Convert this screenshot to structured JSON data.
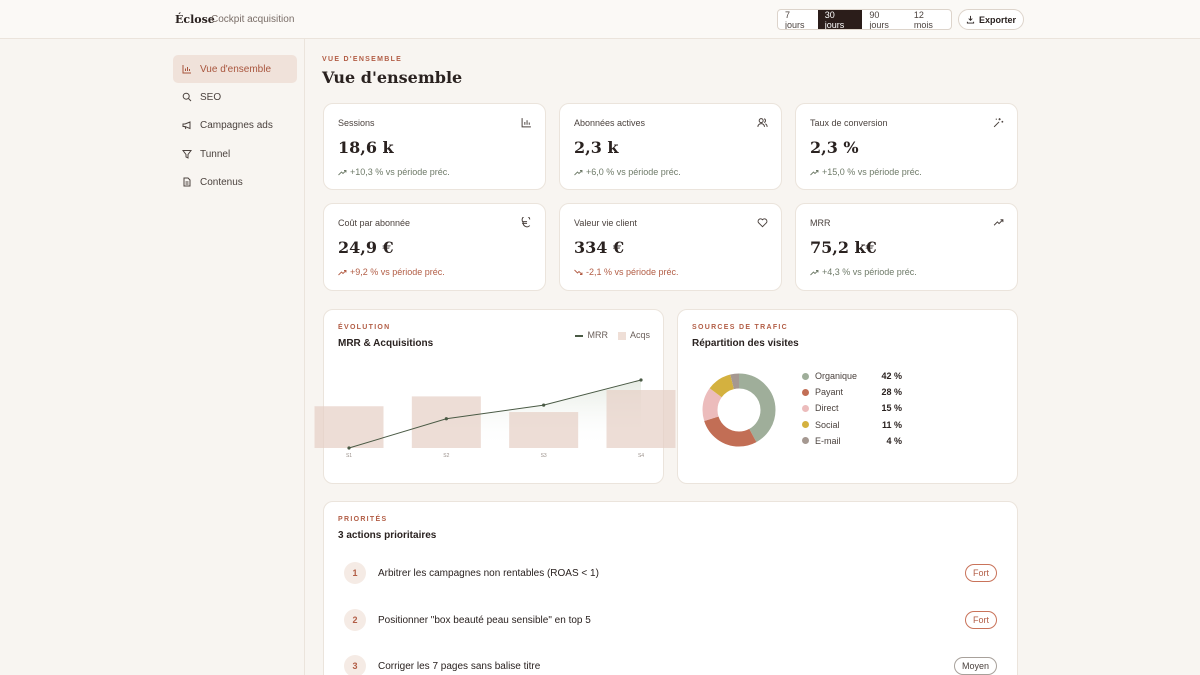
{
  "header": {
    "brand": "Éclose",
    "subtitle": "Cockpit acquisition",
    "periods": [
      "7 jours",
      "30 jours",
      "90 jours",
      "12 mois"
    ],
    "active_period": "30 jours",
    "export_label": "Exporter"
  },
  "sidebar": {
    "items": [
      {
        "label": "Vue d'ensemble",
        "icon": "bar-chart-icon",
        "active": true
      },
      {
        "label": "SEO",
        "icon": "search-icon",
        "active": false
      },
      {
        "label": "Campagnes ads",
        "icon": "megaphone-icon",
        "active": false
      },
      {
        "label": "Tunnel",
        "icon": "funnel-icon",
        "active": false
      },
      {
        "label": "Contenus",
        "icon": "document-icon",
        "active": false
      }
    ]
  },
  "page": {
    "eyebrow": "VUE D'ENSEMBLE",
    "title": "Vue d'ensemble"
  },
  "kpis": [
    {
      "label": "Sessions",
      "value": "18,6 k",
      "delta": "+10,3 % vs période préc.",
      "trend": "up",
      "icon": "bar-chart-icon"
    },
    {
      "label": "Abonnées actives",
      "value": "2,3 k",
      "delta": "+6,0 % vs période préc.",
      "trend": "up",
      "icon": "users-icon"
    },
    {
      "label": "Taux de conversion",
      "value": "2,3 %",
      "delta": "+15,0 % vs période préc.",
      "trend": "up",
      "icon": "sparkle-icon"
    },
    {
      "label": "Coût par abonnée",
      "value": "24,9 €",
      "delta": "+9,2 % vs période préc.",
      "trend": "up-bad",
      "icon": "euro-icon"
    },
    {
      "label": "Valeur vie client",
      "value": "334 €",
      "delta": "-2,1 % vs période préc.",
      "trend": "down",
      "icon": "heart-icon"
    },
    {
      "label": "MRR",
      "value": "75,2 k€",
      "delta": "+4,3 % vs période préc.",
      "trend": "up",
      "icon": "trend-up-icon"
    }
  ],
  "evolution": {
    "eyebrow": "ÉVOLUTION",
    "title": "MRR & Acquisitions",
    "legend_line": "MRR",
    "legend_bar": "Acqs"
  },
  "chart_data": {
    "type": "bar",
    "categories": [
      "S1",
      "S2",
      "S3",
      "S4"
    ],
    "series": [
      {
        "name": "MRR",
        "values": [
          0,
          0.43,
          0.63,
          1.0
        ]
      },
      {
        "name": "Acqs",
        "values": [
          0.72,
          0.89,
          0.62,
          1.0
        ]
      }
    ]
  },
  "traffic": {
    "eyebrow": "SOURCES DE TRAFIC",
    "title": "Répartition des visites",
    "sources": [
      {
        "name": "Organique",
        "pct": 42,
        "label": "42 %",
        "color": "#9fae9a"
      },
      {
        "name": "Payant",
        "pct": 28,
        "label": "28 %",
        "color": "#c26e55"
      },
      {
        "name": "Direct",
        "pct": 15,
        "label": "15 %",
        "color": "#ecbcbc"
      },
      {
        "name": "Social",
        "pct": 11,
        "label": "11 %",
        "color": "#d4b13f"
      },
      {
        "name": "E-mail",
        "pct": 4,
        "label": "4 %",
        "color": "#a59891"
      }
    ]
  },
  "priorities": {
    "eyebrow": "PRIORITÉS",
    "title": "3 actions prioritaires",
    "items": [
      {
        "num": "1",
        "text": "Arbitrer les campagnes non rentables (ROAS < 1)",
        "badge": "Fort"
      },
      {
        "num": "2",
        "text": "Positionner \"box beauté peau sensible\" en top 5",
        "badge": "Fort"
      },
      {
        "num": "3",
        "text": "Corriger les 7 pages sans balise titre",
        "badge": "Moyen"
      }
    ]
  }
}
